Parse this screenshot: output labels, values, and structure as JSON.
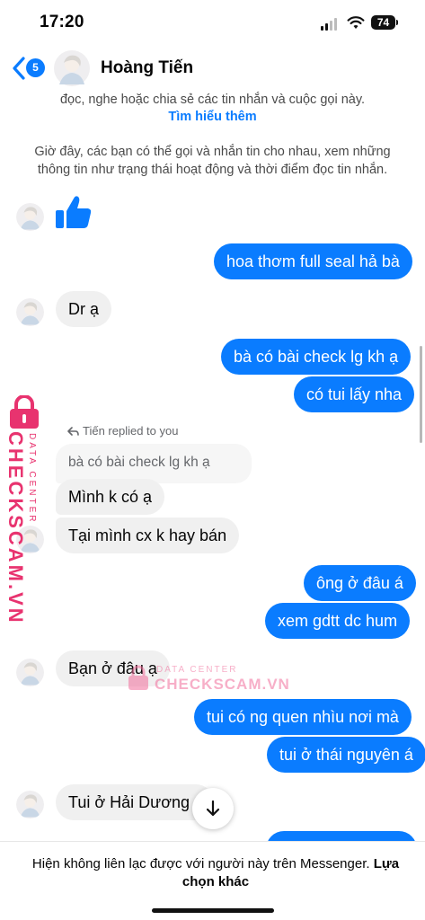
{
  "status_bar": {
    "time": "17:20",
    "battery": "74"
  },
  "header": {
    "unread_count": "5",
    "contact_name": "Hoàng Tiến"
  },
  "notices": {
    "top": "đọc, nghe hoặc chia sẻ các tin nhắn và cuộc gọi này.",
    "learn_more": "Tìm hiểu thêm",
    "info_line1": "Giờ đây, các bạn có thể gọi và nhắn tin cho nhau, xem những",
    "info_line2": "thông tin như trạng thái hoạt động và thời điểm đọc tin nhắn."
  },
  "messages": {
    "m1": "hoa thơm full seal hả bà",
    "m2": "Dr ạ",
    "m3": "bà có bài check lg kh ạ",
    "m4": "có tui lấy nha",
    "reply_label": "Tiến replied to you",
    "quoted": "bà có bài check lg kh ạ",
    "m5": "Mình k có ạ",
    "m6": "Tại mình cx k hay bán",
    "m7": "ông ở đâu á",
    "m8": "xem gdtt dc hum",
    "m9": "Bạn ở đâu ạ",
    "m10": "tui có ng quen nhìu nơi mà",
    "m11": "tui ở thái nguyên á",
    "m12": "Tui ở Hải Dương á"
  },
  "watermark": {
    "vertical_big": "CHECKSCAM.VN",
    "vertical_small": "DATA CENTER",
    "center_small": "DATA CENTER",
    "center_big": "CHECKSCAM.VN"
  },
  "footer": {
    "text": "Hiện không liên lạc được với người này trên Messenger.",
    "link": "Lựa chọn khác"
  },
  "colors": {
    "accent": "#0a7cff",
    "incoming": "#f0f0f0",
    "watermark": "#e8336f"
  }
}
